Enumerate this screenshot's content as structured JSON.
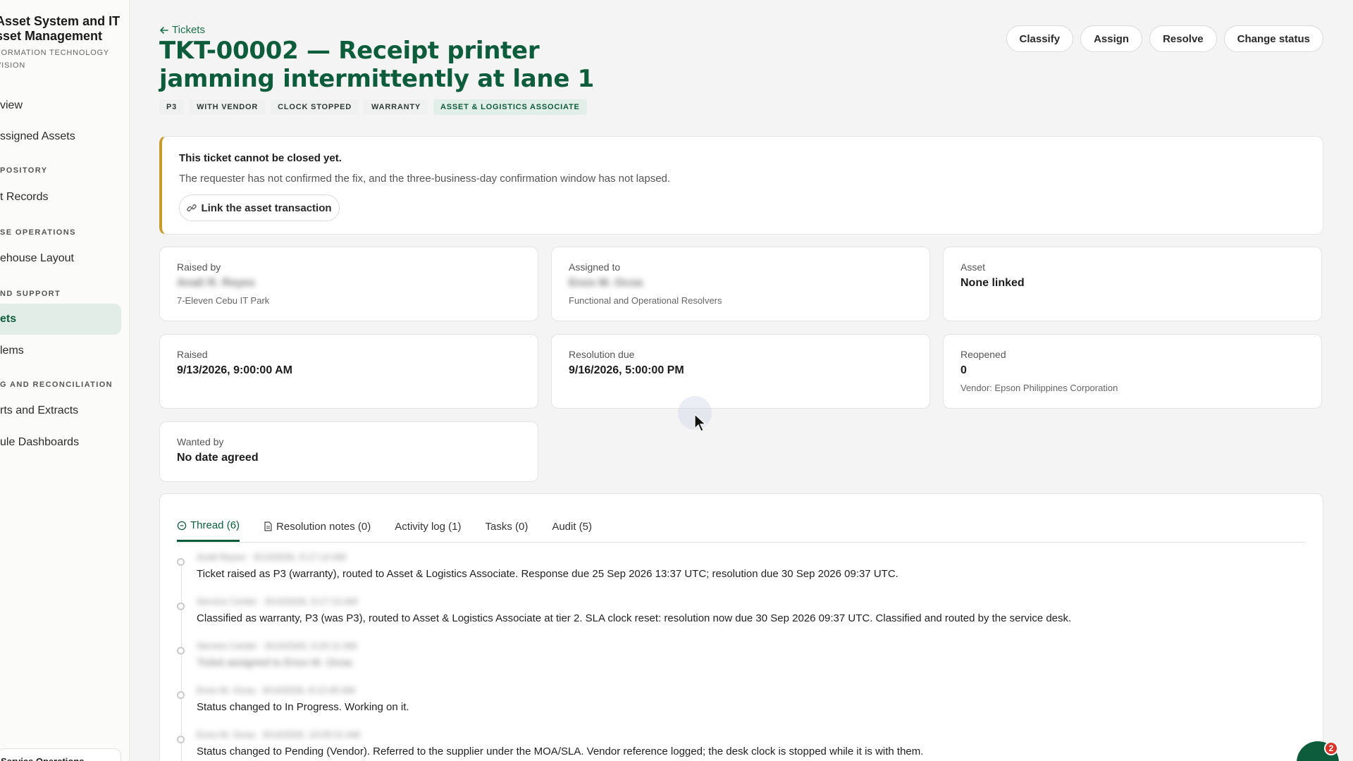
{
  "sidebar": {
    "brand_title": "Asset System and IT\nsset Management",
    "brand_sub": "FORMATION TECHNOLOGY\nVISION",
    "items": [
      {
        "label": "view"
      },
      {
        "label": "ssigned Assets"
      },
      {
        "label": "t Records"
      },
      {
        "label": "ehouse Layout"
      },
      {
        "label": "ets"
      },
      {
        "label": "lems"
      },
      {
        "label": "rts and Extracts"
      },
      {
        "label": "ule Dashboards"
      }
    ],
    "sections": [
      "POSITORY",
      "SE OPERATIONS",
      "ND SUPPORT",
      "G AND RECONCILIATION"
    ],
    "footer_label": "Service Operations"
  },
  "header": {
    "back_label": "Tickets",
    "title": "TKT-00002 — Receipt printer jamming intermittently at lane 1",
    "tags": [
      "P3",
      "WITH VENDOR",
      "CLOCK STOPPED",
      "WARRANTY",
      "ASSET & LOGISTICS ASSOCIATE"
    ]
  },
  "actions": {
    "classify": "Classify",
    "assign": "Assign",
    "resolve": "Resolve",
    "change_status": "Change status"
  },
  "alert": {
    "title": "This ticket cannot be closed yet.",
    "text": "The requester has not confirmed the fix, and the three-business-day confirmation window has not lapsed.",
    "link_label": "Link the asset transaction"
  },
  "cards": {
    "raised_by": {
      "label": "Raised by",
      "value": "Anali R. Reyes",
      "sub": "7-Eleven Cebu IT Park"
    },
    "assigned_to": {
      "label": "Assigned to",
      "value": "Enzo M. Ocoa",
      "sub": "Functional and Operational Resolvers"
    },
    "asset": {
      "label": "Asset",
      "value": "None linked"
    },
    "raised": {
      "label": "Raised",
      "value": "9/13/2026, 9:00:00 AM"
    },
    "resolution_due": {
      "label": "Resolution due",
      "value": "9/16/2026, 5:00:00 PM"
    },
    "reopened": {
      "label": "Reopened",
      "value": "0",
      "sub": "Vendor: Epson Philippines Corporation"
    },
    "wanted_by": {
      "label": "Wanted by",
      "value": "No date agreed"
    }
  },
  "tabs": [
    "Thread (6)",
    "Resolution notes (0)",
    "Activity log (1)",
    "Tasks (0)",
    "Audit (5)"
  ],
  "thread": [
    {
      "meta": "Anali Reyes · 9/13/2026, 9:17:14 AM",
      "text": "Ticket raised as P3 (warranty), routed to Asset & Logistics Associate. Response due 25 Sep 2026 13:37 UTC; resolution due 30 Sep 2026 09:37 UTC."
    },
    {
      "meta": "Service Center · 9/13/2026, 9:17:14 AM",
      "text": "Classified as warranty, P3 (was P3), routed to Asset & Logistics Associate at tier 2. SLA clock reset: resolution now due 30 Sep 2026 09:37 UTC. Classified and routed by the service desk."
    },
    {
      "meta": "Service Center · 9/13/2026, 9:20:11 AM",
      "text": "Ticket assigned to Enzo M. Ocoa."
    },
    {
      "meta": "Enzo M. Ocoa · 9/14/2026, 8:12:45 AM",
      "text": "Status changed to In Progress. Working on it."
    },
    {
      "meta": "Enzo M. Ocoa · 9/14/2026, 10:05:21 AM",
      "text": "Status changed to Pending (Vendor). Referred to the supplier under the MOA/SLA. Vendor reference logged; the desk clock is stopped while it is with them."
    }
  ],
  "widget": {
    "badge": "2"
  },
  "colors": {
    "accent": "#0d5c3b",
    "warning": "#c79a2a",
    "badge": "#d8342a"
  }
}
